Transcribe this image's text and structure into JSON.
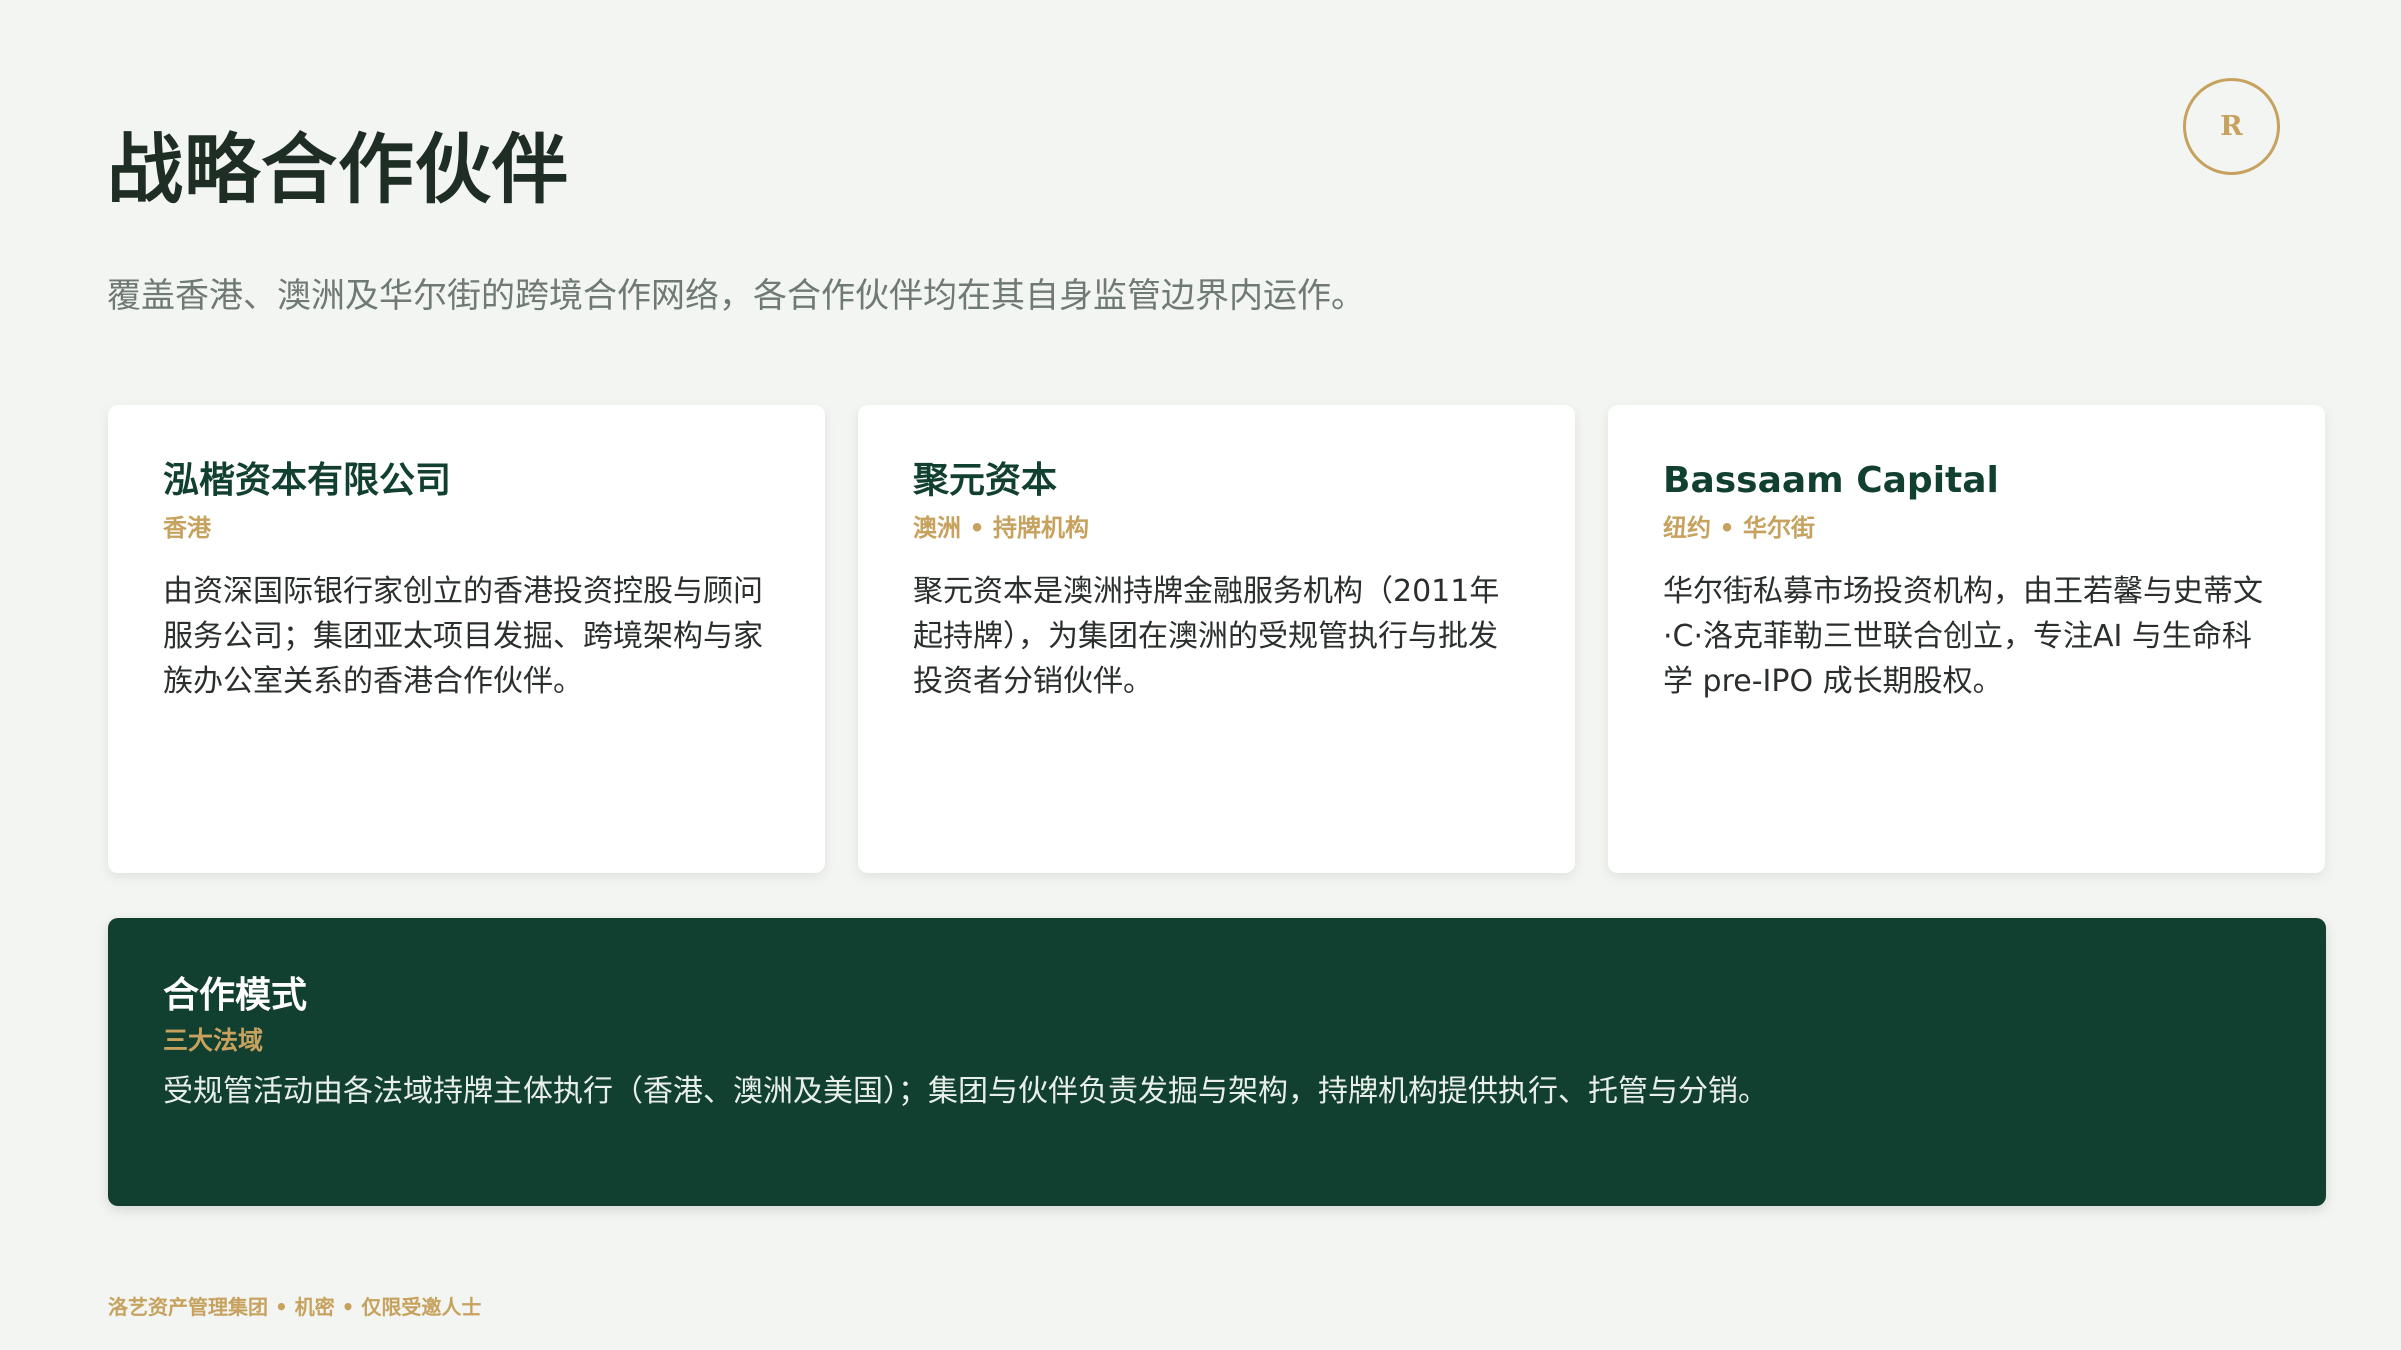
{
  "header": {
    "logo_letter": "R",
    "title": "战略合作伙伴",
    "subtitle": "覆盖香港、澳洲及华尔街的跨境合作网络，各合作伙伴均在其自身监管边界内运作。"
  },
  "partners": [
    {
      "name": "泓楷资本有限公司",
      "region": "香港",
      "description": "由资深国际银行家创立的香港投资控股与顾问服务公司；集团亚太项目发掘、跨境架构与家族办公室关系的香港合作伙伴。"
    },
    {
      "name": "聚元资本",
      "region": "澳洲 • 持牌机构",
      "description": "聚元资本是澳洲持牌金融服务机构（2011年起持牌），为集团在澳洲的受规管执行与批发投资者分销伙伴。"
    },
    {
      "name": "Bassaam Capital",
      "region": "纽约 • 华尔街",
      "description": "华尔街私募市场投资机构，由王若馨与史蒂文·C·洛克菲勒三世联合创立，专注AI 与生命科学 pre-IPO 成长期股权。"
    }
  ],
  "cooperation_model": {
    "title": "合作模式",
    "subtitle": "三大法域",
    "description": "受规管活动由各法域持牌主体执行（香港、澳洲及美国）；集团与伙伴负责发掘与架构，持牌机构提供执行、托管与分销。"
  },
  "footer": {
    "text": "洛艺资产管理集团 • 机密 • 仅限受邀人士"
  },
  "colors": {
    "background": "#f3f5f2",
    "brand_green": "#113f30",
    "accent_gold": "#c6a25e"
  }
}
